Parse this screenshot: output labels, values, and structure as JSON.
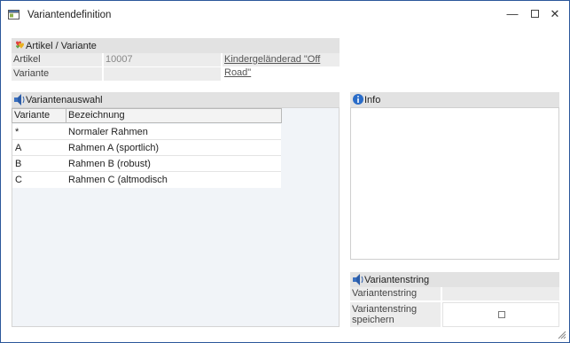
{
  "window": {
    "title": "Variantendefinition",
    "buttons": {
      "minimize": "—",
      "close": "✕"
    }
  },
  "artikel_section": {
    "header": "Artikel / Variante",
    "artikel_label": "Artikel",
    "artikel_number": "10007",
    "artikel_name": "Kindergeländerad \"Off Road\"",
    "variante_label": "Variante",
    "variante_value": ""
  },
  "variantenauswahl": {
    "header": "Variantenauswahl",
    "columns": [
      "Variante",
      "Bezeichnung"
    ],
    "rows": [
      {
        "variante": "*",
        "bezeichnung": "Normaler Rahmen"
      },
      {
        "variante": "A",
        "bezeichnung": "Rahmen A (sportlich)"
      },
      {
        "variante": "B",
        "bezeichnung": "Rahmen B (robust)"
      },
      {
        "variante": "C",
        "bezeichnung": "Rahmen C (altmodisch"
      }
    ]
  },
  "info": {
    "header": "Info"
  },
  "variantenstring": {
    "header": "Variantenstring",
    "string_label": "Variantenstring",
    "string_value": "",
    "save_label_line1": "Variantenstring",
    "save_label_line2": "speichern",
    "save_checked": false
  },
  "colors": {
    "accent": "#2b579a",
    "header_bg": "#e2e2e2",
    "panel_bg": "#f1f4f8"
  },
  "icons": [
    "app-window-icon",
    "minimize-icon",
    "maximize-icon",
    "close-icon",
    "hearts-icon",
    "speaker-icon",
    "info-icon",
    "resize-grip-icon"
  ]
}
